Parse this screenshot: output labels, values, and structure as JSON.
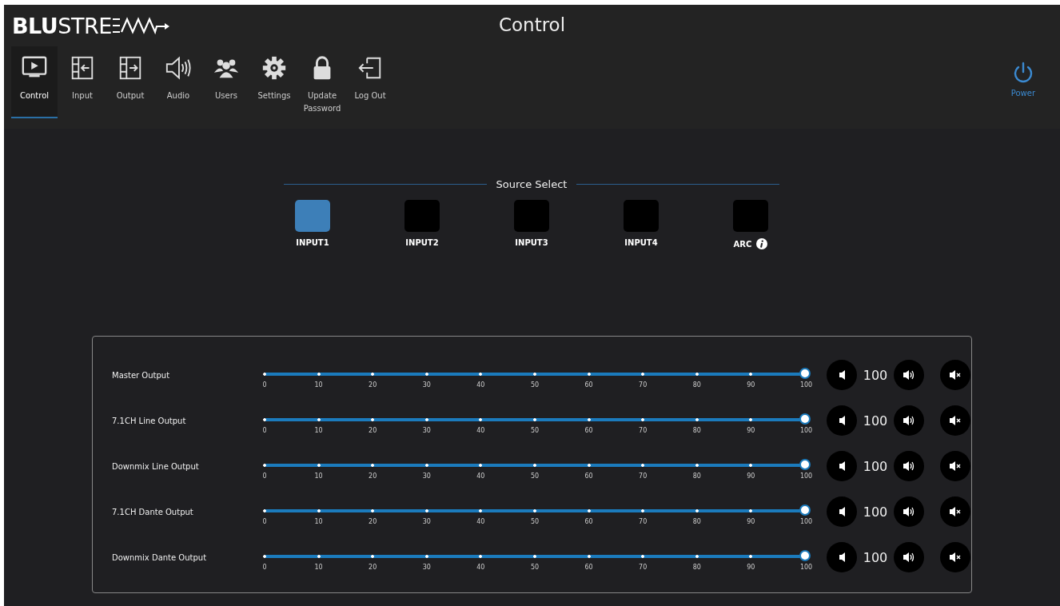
{
  "header": {
    "logo": "**BLU**STRE",
    "title": "Control"
  },
  "nav": [
    {
      "label": "Control",
      "selected": true
    },
    {
      "label": "Input",
      "selected": false
    },
    {
      "label": "Output",
      "selected": false
    },
    {
      "label": "Audio",
      "selected": false
    },
    {
      "label": "Users",
      "selected": false
    },
    {
      "label": "Settings",
      "selected": false
    },
    {
      "label": "Update Password",
      "selected": false
    },
    {
      "label": "Log Out",
      "selected": false
    }
  ],
  "power": {
    "label": "Power"
  },
  "source_select": {
    "title": "Source Select",
    "sources": [
      {
        "label": "INPUT1",
        "selected": true,
        "info": false
      },
      {
        "label": "INPUT2",
        "selected": false,
        "info": false
      },
      {
        "label": "INPUT3",
        "selected": false,
        "info": false
      },
      {
        "label": "INPUT4",
        "selected": false,
        "info": false
      },
      {
        "label": "ARC",
        "selected": false,
        "info": true
      }
    ]
  },
  "outputs": [
    {
      "name": "Master Output",
      "level": 1,
      "value": "100",
      "scale": [
        "0",
        "10",
        "20",
        "30",
        "40",
        "50",
        "60",
        "70",
        "80",
        "90",
        "100"
      ]
    },
    {
      "name": "7.1CH Line Output",
      "level": 1,
      "value": "100",
      "scale": [
        "0",
        "10",
        "20",
        "30",
        "40",
        "50",
        "60",
        "70",
        "80",
        "90",
        "100"
      ]
    },
    {
      "name": "Downmix Line Output",
      "level": 1,
      "value": "100",
      "scale": [
        "0",
        "10",
        "20",
        "30",
        "40",
        "50",
        "60",
        "70",
        "80",
        "90",
        "100"
      ]
    },
    {
      "name": "7.1CH Dante Output",
      "level": 1,
      "value": "100",
      "scale": [
        "0",
        "10",
        "20",
        "30",
        "40",
        "50",
        "60",
        "70",
        "80",
        "90",
        "100"
      ]
    },
    {
      "name": "Downmix Dante Output",
      "level": 1,
      "value": "100",
      "scale": [
        "0",
        "10",
        "20",
        "30",
        "40",
        "50",
        "60",
        "70",
        "80",
        "90",
        "100"
      ]
    }
  ]
}
